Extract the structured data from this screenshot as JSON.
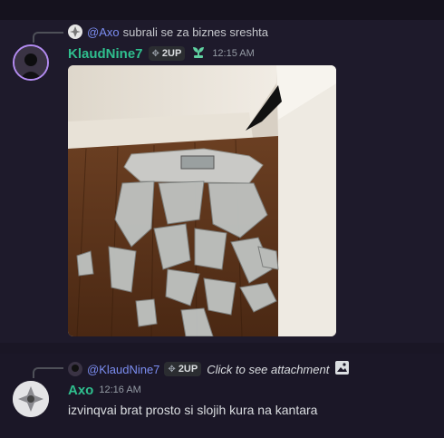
{
  "message1": {
    "reply": {
      "mention": "@Axo",
      "text": "subrali se za biznes sreshta"
    },
    "username": "KlaudNine7",
    "tag": "2UP",
    "time": "12:15 AM"
  },
  "message2": {
    "reply": {
      "mention": "@KlaudNine7",
      "tag": "2UP",
      "text": "Click to see attachment"
    },
    "username": "Axo",
    "time": "12:16 AM",
    "content": "izvinqvai brat prosto si slojih kura na kantara"
  },
  "colors": {
    "klaud_name": "#2fbf8e",
    "axo_name": "#2fbf8e",
    "mention": "#7b8df0",
    "avatar_ring": "#b48cf2"
  },
  "icons": [
    "clan-tag-icon",
    "plant-badge-icon",
    "image-icon"
  ]
}
